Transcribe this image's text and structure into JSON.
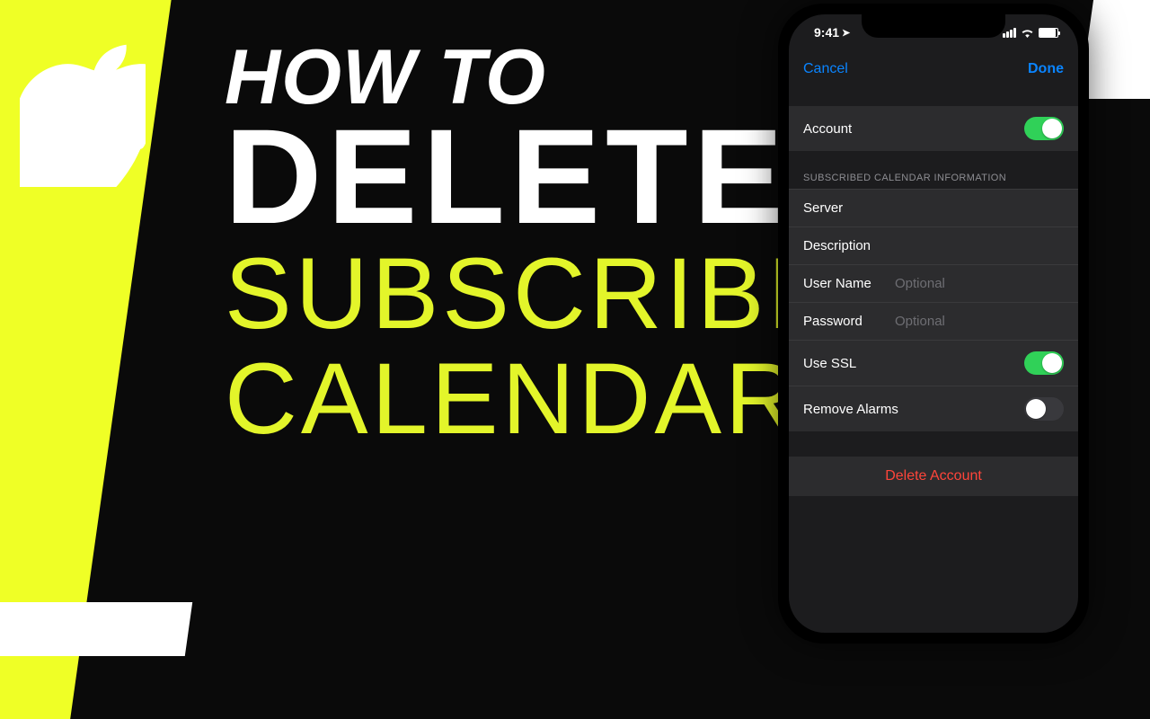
{
  "headline": {
    "line1": "How to",
    "line2": "DELETE",
    "line3": "Subscribed",
    "line4": "Calendar"
  },
  "phone": {
    "status": {
      "time": "9:41"
    },
    "nav": {
      "cancel": "Cancel",
      "done": "Done"
    },
    "account": {
      "label": "Account",
      "enabled": true
    },
    "section_header": "SUBSCRIBED CALENDAR INFORMATION",
    "rows": {
      "server": {
        "label": "Server",
        "value": ""
      },
      "description": {
        "label": "Description",
        "value": ""
      },
      "username": {
        "label": "User Name",
        "placeholder": "Optional"
      },
      "password": {
        "label": "Password",
        "placeholder": "Optional"
      },
      "use_ssl": {
        "label": "Use SSL",
        "enabled": true
      },
      "remove_alarms": {
        "label": "Remove Alarms",
        "enabled": false
      }
    },
    "delete_label": "Delete Account"
  }
}
